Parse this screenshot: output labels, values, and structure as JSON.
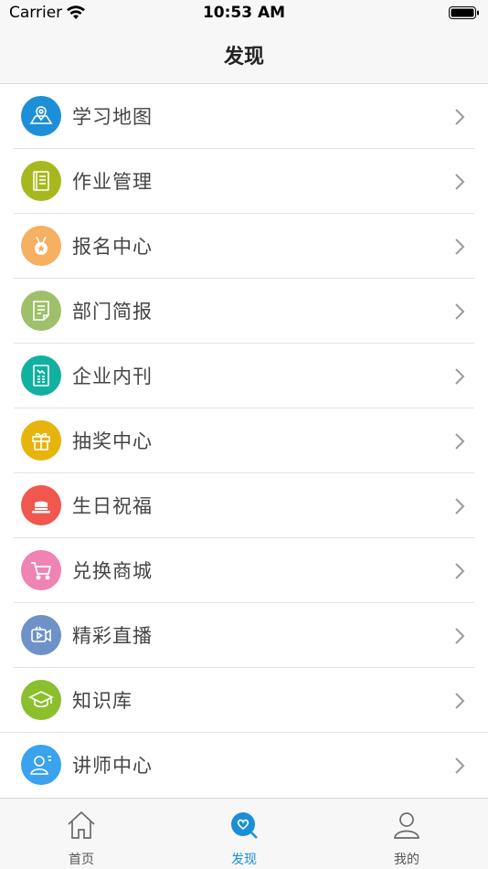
{
  "status_bar": {
    "carrier": "Carrier",
    "time": "10:53 AM"
  },
  "nav": {
    "title": "发现"
  },
  "menu": {
    "items": [
      {
        "label": "学习地图",
        "icon": "map-pin-icon",
        "color": "#1d8fd6"
      },
      {
        "label": "作业管理",
        "icon": "notebook-icon",
        "color": "#a7b81f"
      },
      {
        "label": "报名中心",
        "icon": "medal-icon",
        "color": "#f5b061"
      },
      {
        "label": "部门简报",
        "icon": "document-icon",
        "color": "#9ec06a"
      },
      {
        "label": "企业内刊",
        "icon": "magazine-icon",
        "color": "#12b0a0"
      },
      {
        "label": "抽奖中心",
        "icon": "gift-icon",
        "color": "#e6b40b"
      },
      {
        "label": "生日祝福",
        "icon": "cake-icon",
        "color": "#f0574e"
      },
      {
        "label": "兑换商城",
        "icon": "cart-icon",
        "color": "#ef83b4"
      },
      {
        "label": "精彩直播",
        "icon": "video-icon",
        "color": "#6e91c8"
      },
      {
        "label": "知识库",
        "icon": "graduation-cap-icon",
        "color": "#8cbf2e"
      },
      {
        "label": "讲师中心",
        "icon": "lecturer-icon",
        "color": "#3ba2ee"
      }
    ]
  },
  "tabs": [
    {
      "label": "首页",
      "icon": "home-icon",
      "active": false
    },
    {
      "label": "发现",
      "icon": "discover-icon",
      "active": true
    },
    {
      "label": "我的",
      "icon": "profile-icon",
      "active": false
    }
  ],
  "colors": {
    "accent": "#1a8fd8"
  }
}
